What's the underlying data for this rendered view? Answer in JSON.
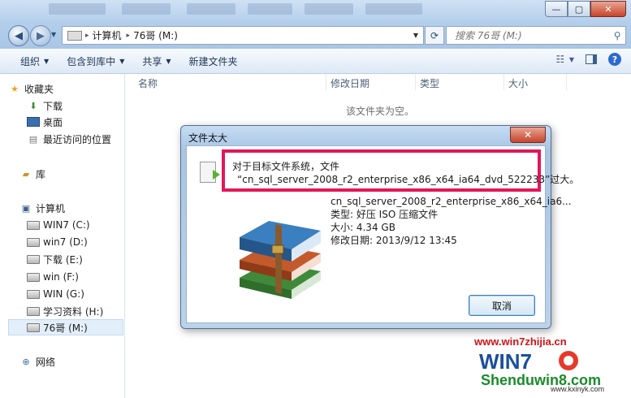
{
  "window": {
    "caption_buttons": {
      "minimize": "—",
      "maximize": "▢",
      "close": "✕"
    }
  },
  "address": {
    "computer": "计算机",
    "separator": "▸",
    "drive": "76哥 (M:)"
  },
  "search": {
    "placeholder": "搜索 76哥 (M:)"
  },
  "toolbar": {
    "organize": "组织",
    "include_library": "包含到库中",
    "share": "共享",
    "new_folder": "新建文件夹"
  },
  "sidebar": {
    "favorites": "收藏夹",
    "downloads": "下载",
    "desktop": "桌面",
    "recent": "最近访问的位置",
    "libraries": "库",
    "computer": "计算机",
    "drives": [
      "WIN7 (C:)",
      "win7 (D:)",
      "下载 (E:)",
      "win (F:)",
      "WIN (G:)",
      "学习资料 (H:)",
      "76哥 (M:)"
    ],
    "network": "网络"
  },
  "columns": {
    "name": "名称",
    "modified": "修改日期",
    "type": "类型",
    "size": "大小"
  },
  "content": {
    "empty": "该文件夹为空。"
  },
  "dialog": {
    "title": "文件太大",
    "message_line1": "对于目标文件系统，文件",
    "message_line2": "“cn_sql_server_2008_r2_enterprise_x86_x64_ia64_dvd_522233”过大。",
    "file_name": "cn_sql_server_2008_r2_enterprise_x86_x64_ia6...",
    "file_type": "类型: 好压 ISO 压缩文件",
    "file_size": "大小: 4.34 GB",
    "file_modified": "修改日期: 2013/9/12 13:45",
    "cancel": "取消",
    "accent_color": "#e3175a"
  },
  "watermark": {
    "url": "www.win7zhijia.cn",
    "logo_text": "WIN7",
    "brand": "Shenduwin8.com",
    "small": "www.kxinyk.com",
    "color": "#d31016"
  }
}
